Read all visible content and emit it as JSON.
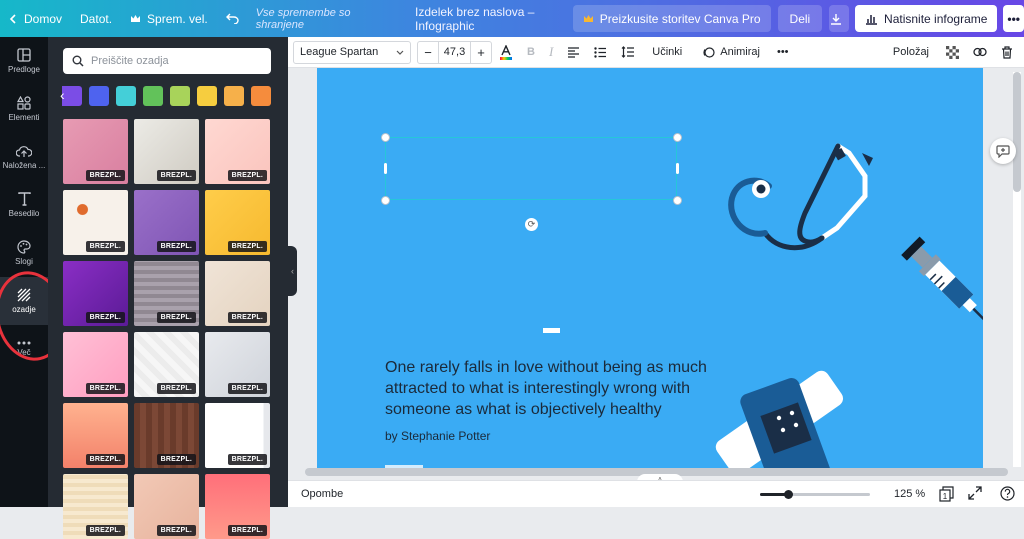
{
  "topbar": {
    "home": "Domov",
    "file": "Datot.",
    "resize": "Sprem. vel.",
    "saved": "Vse spremembe so shranjene",
    "doc_title": "Izdelek brez naslova – Infographic",
    "pro": "Preizkusite storitev Canva Pro",
    "share": "Deli",
    "print": "Natisnite infograme",
    "more": "•••"
  },
  "rail": {
    "items": [
      {
        "label": "Predloge",
        "icon": "template-icon"
      },
      {
        "label": "Elementi",
        "icon": "elements-icon"
      },
      {
        "label": "Naložena ...",
        "icon": "upload-icon"
      },
      {
        "label": "Besedilo",
        "icon": "text-icon"
      },
      {
        "label": "Slogi",
        "icon": "palette-icon"
      },
      {
        "label": "ozadje",
        "icon": "background-icon"
      },
      {
        "label": "Več",
        "icon": "more-icon"
      }
    ]
  },
  "panel": {
    "search_placeholder": "Preiščite ozadja",
    "swatches": [
      "#7b4de6",
      "#4e63ef",
      "#44cfd8",
      "#62c25a",
      "#a8d35a",
      "#f6cd3f",
      "#f6b04a",
      "#f58c3d"
    ],
    "badge": "BREZPL.",
    "tiles": [
      "linear-gradient(135deg,#e79bb3,#d97fa0)",
      "linear-gradient(135deg,#ecebe6,#cfcbc2)",
      "linear-gradient(135deg,#ffd8d2,#fac4bd)",
      "radial-gradient(circle at 30% 30%,#e06b2d 0 8%,#f7f1ea 9% 100%)",
      "linear-gradient(135deg,#9a70c9,#7f55b4)",
      "linear-gradient(135deg,#ffcd4a,#f6b92f)",
      "linear-gradient(135deg,#8a2ec5,#5b1b96)",
      "repeating-linear-gradient(0deg,#a9a1ac 0 4px,#908892 4px 8px)",
      "linear-gradient(135deg,#f0e4d7,#e4d3c0)",
      "linear-gradient(135deg,#ffc0d6,#ff9ec0)",
      "repeating-linear-gradient(45deg,#f6f6f6 0 6px,#ececec 6px 12px)",
      "linear-gradient(135deg,#e8eaee,#cfd3da)",
      "linear-gradient(180deg,#ffb28f,#f3816a)",
      "repeating-linear-gradient(90deg,#6a3b2b 0 6px,#7c4836 6px 12px)",
      "linear-gradient(90deg,#ffffff 0 90%,#e6e8ec 90% 100%)",
      "repeating-linear-gradient(0deg,#f7e9cf 0 4px,#efdcb9 4px 8px)",
      "linear-gradient(135deg,#f2c9b6,#e7b39d)",
      "linear-gradient(180deg,#ff6f7a,#ff9a8a)"
    ]
  },
  "toolbar": {
    "font": "League Spartan",
    "minus": "−",
    "size": "47,3",
    "plus": "+",
    "effects": "Učinki",
    "animate": "Animiraj",
    "more": "•••",
    "position": "Položaj"
  },
  "canvas": {
    "quote": "One rarely falls in love without being as much attracted to what is interestingly wrong with someone as what is objectively healthy",
    "author": "by Stephanie Potter"
  },
  "footer": {
    "notes": "Opombe",
    "zoom": "125 %",
    "zoom_level": 0.25,
    "page_count": "1"
  },
  "colors": {
    "page_bg": "#3aabf4",
    "accent": "#7d2ae8",
    "selection": "#26c6d9"
  }
}
